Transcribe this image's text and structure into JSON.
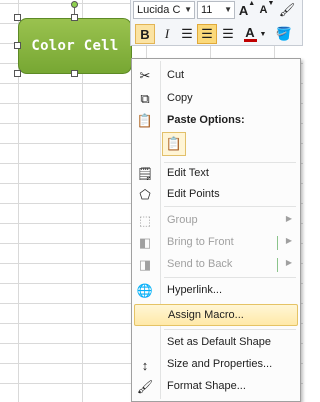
{
  "shape": {
    "text": "Color Cell"
  },
  "mini_toolbar": {
    "font_name": "Lucida C",
    "font_size": "11",
    "grow_font": "A",
    "shrink_font": "A",
    "bold": "B",
    "italic": "I",
    "font_color_letter": "A"
  },
  "menu": {
    "cut": "Cut",
    "copy": "Copy",
    "paste_options": "Paste Options:",
    "edit_text": "Edit Text",
    "edit_points": "Edit Points",
    "group": "Group",
    "bring_to_front": "Bring to Front",
    "send_to_back": "Send to Back",
    "hyperlink": "Hyperlink...",
    "assign_macro": "Assign Macro...",
    "set_default_shape": "Set as Default Shape",
    "size_properties": "Size and Properties...",
    "format_shape": "Format Shape..."
  },
  "colors": {
    "shape_fill": "#8cb844",
    "highlight": "#ffe9a8"
  }
}
